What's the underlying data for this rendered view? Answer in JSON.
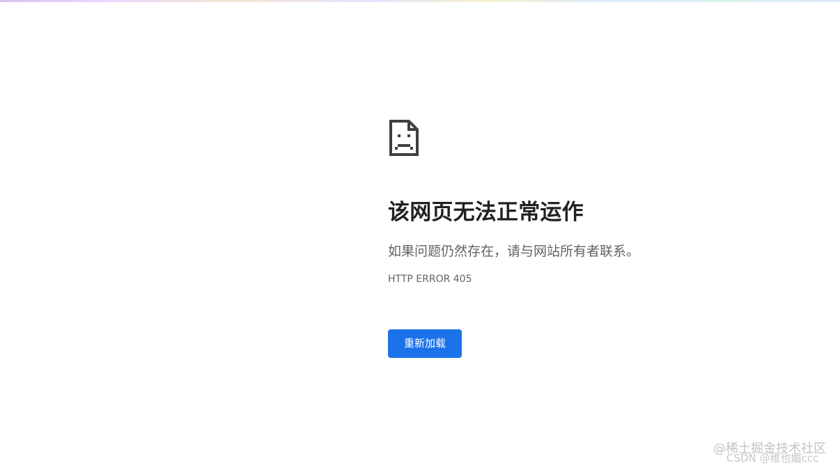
{
  "icon": {
    "name": "sad-page-icon",
    "color": "#3c4043"
  },
  "error": {
    "title": "该网页无法正常运作",
    "message": "如果问题仍然存在，请与网站所有者联系。",
    "code": "HTTP ERROR 405"
  },
  "actions": {
    "reload_label": "重新加载"
  },
  "watermarks": {
    "primary": "@稀土掘金技术社区",
    "secondary": "CSDN @维也媚ccc"
  },
  "colors": {
    "background": "#ffffff",
    "title": "#202124",
    "secondary_text": "#5f6368",
    "button": "#1a73e8",
    "button_text": "#ffffff"
  }
}
